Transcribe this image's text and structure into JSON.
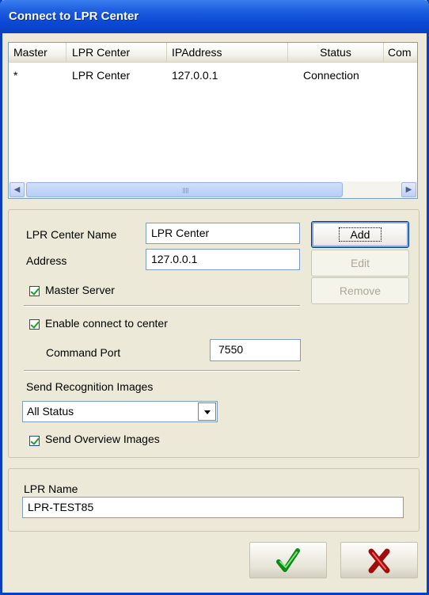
{
  "window": {
    "title": "Connect to LPR Center"
  },
  "list": {
    "columns": [
      "Master",
      "LPR Center",
      "IPAddress",
      "Status",
      "Com"
    ],
    "rows": [
      {
        "master": "*",
        "center": "LPR Center",
        "ip": "127.0.0.1",
        "status": "Connection"
      }
    ]
  },
  "center_group": {
    "name_label": "LPR Center Name",
    "name_value": "LPR Center",
    "address_label": "Address",
    "address_value": "127.0.0.1",
    "master_server_label": "Master Server",
    "master_server_checked": true,
    "enable_connect_label": "Enable connect to center",
    "enable_connect_checked": true,
    "command_port_label": "Command Port",
    "command_port_value": "7550",
    "send_images_label": "Send Recognition Images",
    "send_images_selected": "All Status",
    "send_overview_label": "Send Overview Images",
    "send_overview_checked": true,
    "add_label": "Add",
    "edit_label": "Edit",
    "remove_label": "Remove"
  },
  "lpr_group": {
    "name_label": "LPR Name",
    "name_value": "LPR-TEST85"
  },
  "footer": {
    "ok_icon": "check-icon",
    "cancel_icon": "x-icon"
  }
}
